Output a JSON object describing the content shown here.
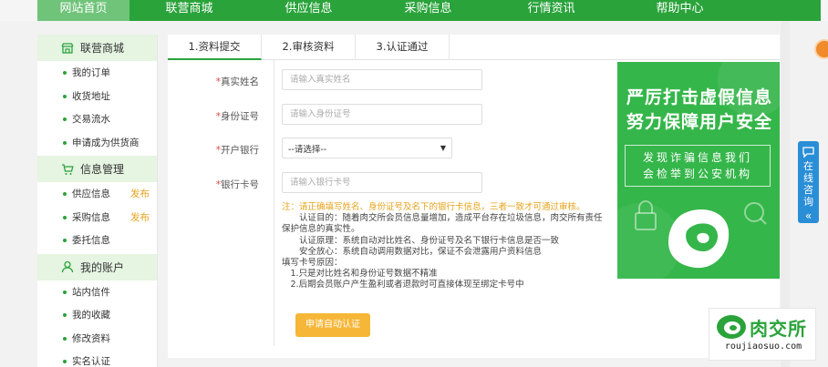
{
  "nav": {
    "items": [
      {
        "label": "网站首页",
        "active": true
      },
      {
        "label": "联营商城",
        "active": false
      },
      {
        "label": "供应信息",
        "active": false
      },
      {
        "label": "采购信息",
        "active": false
      },
      {
        "label": "行情资讯",
        "active": false
      },
      {
        "label": "帮助中心",
        "active": false
      }
    ]
  },
  "sidebar": {
    "groups": [
      {
        "title": "联营商城",
        "icon": "shop-icon",
        "items": [
          {
            "label": "我的订单"
          },
          {
            "label": "收货地址"
          },
          {
            "label": "交易流水"
          },
          {
            "label": "申请成为供货商"
          }
        ]
      },
      {
        "title": "信息管理",
        "icon": "cart-icon",
        "items": [
          {
            "label": "供应信息",
            "badge": "发布"
          },
          {
            "label": "采购信息",
            "badge": "发布"
          },
          {
            "label": "委托信息"
          }
        ]
      },
      {
        "title": "我的账户",
        "icon": "user-icon",
        "items": [
          {
            "label": "站内信件"
          },
          {
            "label": "我的收藏"
          },
          {
            "label": "修改资料"
          },
          {
            "label": "实名认证"
          }
        ]
      }
    ]
  },
  "steps": [
    {
      "label": "1.资料提交",
      "active": true
    },
    {
      "label": "2.审核资料",
      "active": false
    },
    {
      "label": "3.认证通过",
      "active": false
    }
  ],
  "form": {
    "required_mark": "*",
    "name_label": "真实姓名",
    "name_placeholder": "请输入真实姓名",
    "id_label": "身份证号",
    "id_placeholder": "请输入身份证号",
    "bank_label": "开户银行",
    "bank_selected": "--请选择--",
    "card_label": "银行卡号",
    "card_placeholder": "请输入银行卡号"
  },
  "notes": {
    "warning": "注：请正确填写姓名、身份证号及名下的银行卡信息，三者一致才可通过审核。",
    "purpose": "认证目的：随着肉交所会员信息量增加，造成平台存在垃圾信息，肉交所有责任保护信息的真实性。",
    "principle": "认证原理：系统自动对比姓名、身份证号及名下银行卡信息是否一致",
    "safety": "安全放心：系统自动调用数据对比，保证不会泄露用户资料信息",
    "reason_title": "填写卡号原因：",
    "reason_1": "1.只是对比姓名和身份证号数据不精准",
    "reason_2": "2.后期会员账户产生盈利或者退款时可直接体现至绑定卡号中"
  },
  "submit_label": "申请自动认证",
  "banner": {
    "line1": "严厉打击虚假信息",
    "line2": "努力保障用户安全",
    "box_line1": "发现诈骗信息我们",
    "box_line2": "会检举到公安机构"
  },
  "float_tab": {
    "label": "在线咨询",
    "chevron": "«"
  },
  "logo": {
    "name": "肉交所",
    "domain": "roujiaosuo.com"
  },
  "colors": {
    "brand_green": "#2aa33b",
    "accent_orange": "#f6b637",
    "tab_blue": "#2a8ed6"
  }
}
